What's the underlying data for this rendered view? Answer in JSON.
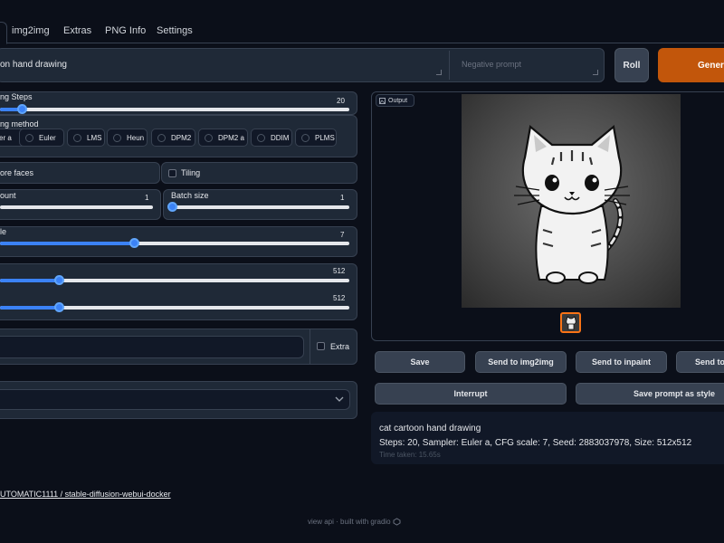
{
  "tabs": [
    "img2img",
    "Extras",
    "PNG Info",
    "Settings"
  ],
  "prompt": {
    "value": "on hand drawing",
    "negative_placeholder": "Negative prompt"
  },
  "buttons": {
    "roll": "Roll",
    "generate": "Genera"
  },
  "sampling_steps": {
    "label": "ng Steps",
    "value": "20",
    "fraction": 0.05
  },
  "sampling_method": {
    "label": "ng method",
    "options": [
      "er a",
      "Euler",
      "LMS",
      "Heun",
      "DPM2",
      "DPM2 a",
      "DDIM",
      "PLMS"
    ]
  },
  "checkboxes": {
    "restore_faces": "ore faces",
    "tiling": "Tiling"
  },
  "batch_count": {
    "label": "ount",
    "value": "1"
  },
  "batch_size": {
    "label": "Batch size",
    "value": "1"
  },
  "cfg_scale": {
    "label": "le",
    "value": "7"
  },
  "width": {
    "value": "512"
  },
  "height": {
    "value": "512"
  },
  "seed": {
    "extra_label": "Extra"
  },
  "output": {
    "label": "Output"
  },
  "actions": {
    "save": "Save",
    "send_img2img": "Send to img2img",
    "send_inpaint": "Send to inpaint",
    "send_extras": "Send to",
    "interrupt": "Interrupt",
    "save_style": "Save prompt as style"
  },
  "info": {
    "prompt": "cat cartoon hand drawing",
    "params": "Steps: 20, Sampler: Euler a, CFG scale: 7, Seed: 2883037978, Size: 512x512",
    "time": "Time taken: 15.65s"
  },
  "footer": {
    "link": "UTOMATIC1111 / stable-diffusion-webui-docker",
    "api": "view api",
    "built": "built with gradio"
  },
  "colors": {
    "accent": "#3b82f6",
    "generate": "#c2560b",
    "background": "#0b0f19"
  }
}
